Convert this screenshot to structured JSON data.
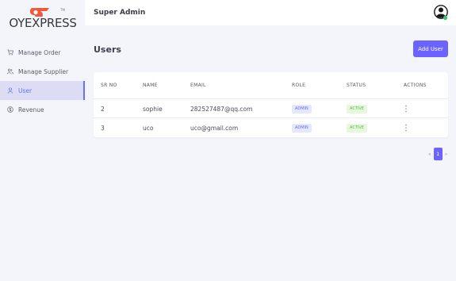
{
  "brand": {
    "logo_text": "OYEXPRESS",
    "logo_sup": "TM",
    "accent": "#6c63ff",
    "logo_color": "#f05a3c"
  },
  "sidebar": {
    "items": [
      {
        "label": "Manage Order",
        "icon": "cart-icon",
        "active": false
      },
      {
        "label": "Manage Supplier",
        "icon": "users-icon",
        "active": false
      },
      {
        "label": "User",
        "icon": "user-icon",
        "active": true
      },
      {
        "label": "Revenue",
        "icon": "dollar-circle-icon",
        "active": false
      }
    ]
  },
  "header": {
    "title": "Super Admin",
    "avatar_icon": "user-avatar-icon"
  },
  "main": {
    "title": "Users",
    "add_button": "Add User",
    "table": {
      "columns": [
        "SR NO",
        "NAME",
        "EMAIL",
        "ROLE",
        "STATUS",
        "ACTIONS"
      ],
      "rows": [
        {
          "sr": "2",
          "name": "sophie",
          "email": "282527487@qq.com",
          "role": "ADMIN",
          "status": "ACTIVE"
        },
        {
          "sr": "3",
          "name": "uco",
          "email": "uco@gmail.com",
          "role": "ADMIN",
          "status": "ACTIVE"
        }
      ]
    },
    "pagination": {
      "prev": "«",
      "current": "1",
      "next": "»"
    }
  }
}
